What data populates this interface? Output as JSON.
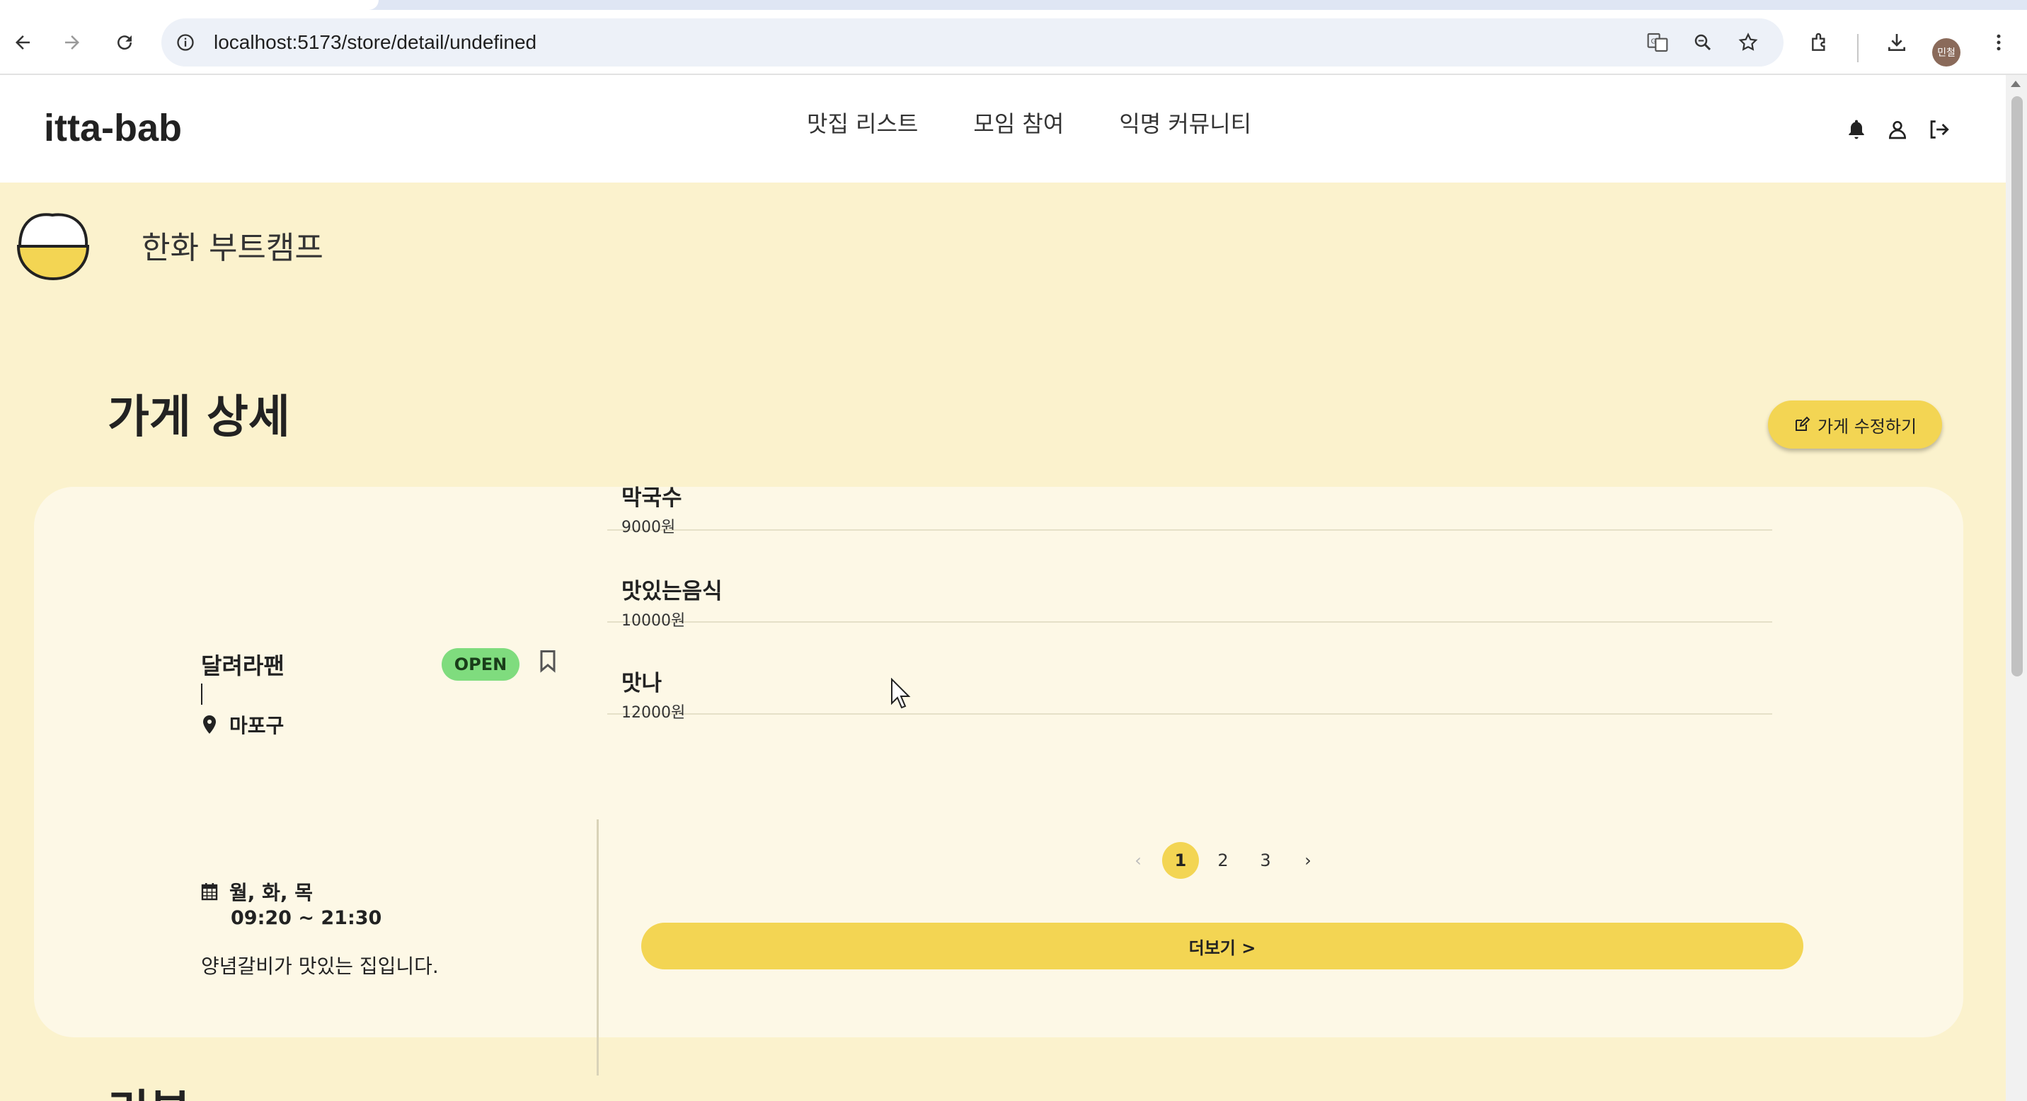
{
  "browser": {
    "url": "localhost:5173/store/detail/undefined",
    "profile_initials": "민철"
  },
  "header": {
    "logo": "itta-bab",
    "nav": [
      "맛집 리스트",
      "모임 참여",
      "익명 커뮤니티"
    ]
  },
  "org": {
    "name": "한화 부트캠프"
  },
  "page": {
    "title": "가게 상세",
    "edit_label": "가게 수정하기"
  },
  "store": {
    "name": "달려라팬",
    "status": "OPEN",
    "location": "마포구",
    "days": "월, 화, 목",
    "hours": "09:20 ~ 21:30",
    "description": "양념갈비가 맛있는 집입니다."
  },
  "menu": [
    {
      "name": "막국수",
      "price": "9000원"
    },
    {
      "name": "맛있는음식",
      "price": "10000원"
    },
    {
      "name": "맛나",
      "price": "12000원"
    }
  ],
  "pagination": {
    "prev": "‹",
    "pages": [
      "1",
      "2",
      "3"
    ],
    "next": "›",
    "current": "1"
  },
  "more_label": "더보기 >",
  "review": {
    "heading": "리뷰"
  },
  "colors": {
    "accent": "#f3d553",
    "background": "#fbf2cd",
    "card": "#fdf8e6",
    "open": "#7fdc7e"
  }
}
